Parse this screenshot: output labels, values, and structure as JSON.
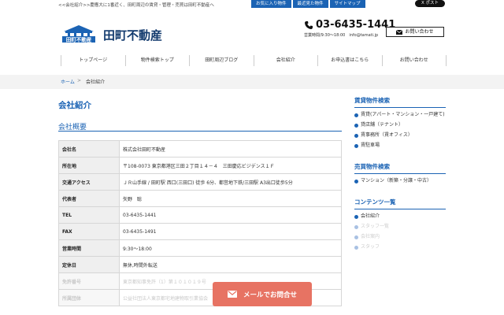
{
  "topbar": {
    "tagline": "<<会社紹介>>慶應大に1番近く、田町周辺の賃貸・管理・売買は田町不動産へ",
    "buttons": [
      "お気に入り物件",
      "最近見た物件",
      "サイトマップ"
    ],
    "x_post": "X ポスト"
  },
  "header": {
    "logo_text": "田町不動産",
    "company_name": "田町不動産",
    "phone": "03-6435-1441",
    "hours": "営業時間/9:30〜18:00　info@tamati.jp",
    "contact_button": "お問い合わせ"
  },
  "nav": [
    "トップページ",
    "物件検索トップ",
    "田町周辺ブログ",
    "会社紹介",
    "お申込書はこちら",
    "お問い合わせ"
  ],
  "breadcrumb": {
    "home": "ホーム",
    "separator": ">",
    "current": "会社紹介"
  },
  "main": {
    "title": "会社紹介",
    "section_title": "会社概要",
    "rows": [
      {
        "label": "会社名",
        "value": "株式会社田町不動産"
      },
      {
        "label": "所在地",
        "value": "〒108-0073 東京都港区三田２丁目１４－４　三田慶応ビジデンス１Ｆ"
      },
      {
        "label": "交通アクセス",
        "value": "ＪＲ山手線 / 田町駅 西口(三田口) 徒歩 6分、都営地下鉄/三田駅 A3出口徒歩5分"
      },
      {
        "label": "代表者",
        "value": "矢野　聡"
      },
      {
        "label": "TEL",
        "value": "03-6435-1441"
      },
      {
        "label": "FAX",
        "value": "03-6435-1491"
      },
      {
        "label": "営業時間",
        "value": "9:30〜18:00"
      },
      {
        "label": "定休日",
        "value": "無休,時間外転送"
      },
      {
        "label": "免許番号",
        "value": "東京都知事免許（1）第１０１０１９号"
      },
      {
        "label": "所属団体",
        "value": "公益社団法人東京都宅地建物取引業協会"
      }
    ]
  },
  "sidebar": {
    "sections": [
      {
        "title": "賃貸物件検索",
        "items": [
          "賃貸(アパート・マンション・一戸建て)",
          "貸店舗（テナント）",
          "賃事務所（賃オフィス）",
          "賃駐車場"
        ]
      },
      {
        "title": "売買物件検索",
        "items": [
          "マンション（新築・分譲・中古）"
        ]
      },
      {
        "title": "コンテンツ一覧",
        "items": [
          "会社紹介",
          "スタッフ一覧",
          "会社案内",
          "スタッフ"
        ]
      }
    ]
  },
  "mail_button": "メールでお問合せ",
  "colors": {
    "brand": "#1b63b4",
    "cta": "#e77363",
    "logo_dark": "#123a6d"
  }
}
